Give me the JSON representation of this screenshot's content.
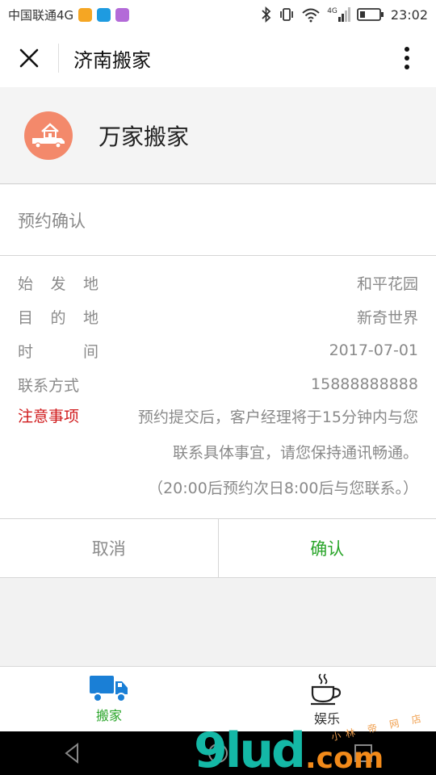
{
  "status_bar": {
    "carrier": "中国联通4G",
    "network": "4G",
    "time": "23:02",
    "icons": [
      "bluetooth-icon",
      "vibrate-icon",
      "wifi-icon",
      "signal-icon",
      "battery-icon"
    ]
  },
  "title_bar": {
    "title": "济南搬家",
    "icons": [
      "close-icon",
      "more-vertical-icon"
    ]
  },
  "company": {
    "name": "万家搬家",
    "logo_icon": "moving-truck-house-icon",
    "logo_color": "#f3896b"
  },
  "confirmation": {
    "title": "预约确认",
    "rows": [
      {
        "label": "始发地",
        "label_chars": [
          "始",
          "发",
          "地"
        ],
        "value": "和平花园"
      },
      {
        "label": "目的地",
        "label_chars": [
          "目",
          "的",
          "地"
        ],
        "value": "新奇世界"
      },
      {
        "label": "时间",
        "label_chars": [
          "时",
          "间"
        ],
        "value": "2017-07-01"
      },
      {
        "label": "联系方式",
        "label_chars": [
          "联系方式"
        ],
        "value": "15888888888"
      }
    ],
    "notice_label": "注意事项",
    "notice_line1": "预约提交后，客户经理将于15分钟内与您",
    "notice_line2": "联系具体事宜，请您保持通讯畅通。",
    "notice_line3": "（20:00后预约次日8:00后与您联系。）",
    "notice_color": "#d0191b"
  },
  "actions": {
    "cancel_label": "取消",
    "confirm_label": "确认",
    "confirm_color": "#2aa52a"
  },
  "tab_bar": {
    "tabs": [
      {
        "label": "搬家",
        "icon": "truck-icon",
        "active": true
      },
      {
        "label": "娱乐",
        "icon": "coffee-cup-icon",
        "active": false
      }
    ]
  },
  "nav_bar": {
    "icons": [
      "back-icon",
      "home-icon",
      "recents-icon"
    ]
  },
  "watermark": {
    "main": "9lud",
    "sub": ".com",
    "small": "小林 帝 网 店"
  }
}
